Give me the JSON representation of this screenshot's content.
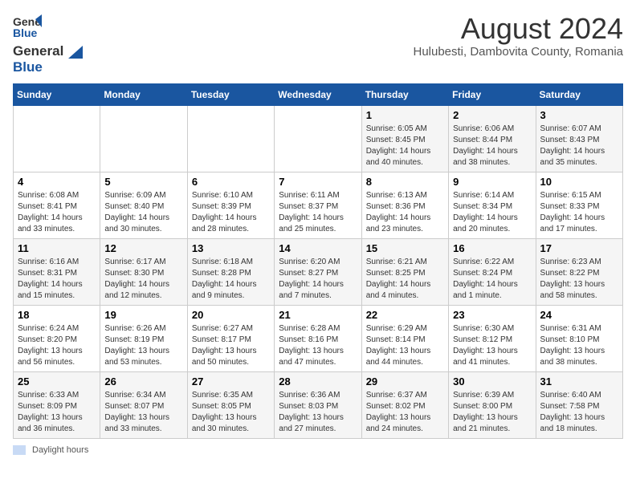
{
  "header": {
    "logo_general": "General",
    "logo_blue": "Blue",
    "month_title": "August 2024",
    "location": "Hulubesti, Dambovita County, Romania"
  },
  "weekdays": [
    "Sunday",
    "Monday",
    "Tuesday",
    "Wednesday",
    "Thursday",
    "Friday",
    "Saturday"
  ],
  "legend": {
    "box_label": "Daylight hours"
  },
  "weeks": [
    [
      {
        "day": "",
        "info": ""
      },
      {
        "day": "",
        "info": ""
      },
      {
        "day": "",
        "info": ""
      },
      {
        "day": "",
        "info": ""
      },
      {
        "day": "1",
        "info": "Sunrise: 6:05 AM\nSunset: 8:45 PM\nDaylight: 14 hours\nand 40 minutes."
      },
      {
        "day": "2",
        "info": "Sunrise: 6:06 AM\nSunset: 8:44 PM\nDaylight: 14 hours\nand 38 minutes."
      },
      {
        "day": "3",
        "info": "Sunrise: 6:07 AM\nSunset: 8:43 PM\nDaylight: 14 hours\nand 35 minutes."
      }
    ],
    [
      {
        "day": "4",
        "info": "Sunrise: 6:08 AM\nSunset: 8:41 PM\nDaylight: 14 hours\nand 33 minutes."
      },
      {
        "day": "5",
        "info": "Sunrise: 6:09 AM\nSunset: 8:40 PM\nDaylight: 14 hours\nand 30 minutes."
      },
      {
        "day": "6",
        "info": "Sunrise: 6:10 AM\nSunset: 8:39 PM\nDaylight: 14 hours\nand 28 minutes."
      },
      {
        "day": "7",
        "info": "Sunrise: 6:11 AM\nSunset: 8:37 PM\nDaylight: 14 hours\nand 25 minutes."
      },
      {
        "day": "8",
        "info": "Sunrise: 6:13 AM\nSunset: 8:36 PM\nDaylight: 14 hours\nand 23 minutes."
      },
      {
        "day": "9",
        "info": "Sunrise: 6:14 AM\nSunset: 8:34 PM\nDaylight: 14 hours\nand 20 minutes."
      },
      {
        "day": "10",
        "info": "Sunrise: 6:15 AM\nSunset: 8:33 PM\nDaylight: 14 hours\nand 17 minutes."
      }
    ],
    [
      {
        "day": "11",
        "info": "Sunrise: 6:16 AM\nSunset: 8:31 PM\nDaylight: 14 hours\nand 15 minutes."
      },
      {
        "day": "12",
        "info": "Sunrise: 6:17 AM\nSunset: 8:30 PM\nDaylight: 14 hours\nand 12 minutes."
      },
      {
        "day": "13",
        "info": "Sunrise: 6:18 AM\nSunset: 8:28 PM\nDaylight: 14 hours\nand 9 minutes."
      },
      {
        "day": "14",
        "info": "Sunrise: 6:20 AM\nSunset: 8:27 PM\nDaylight: 14 hours\nand 7 minutes."
      },
      {
        "day": "15",
        "info": "Sunrise: 6:21 AM\nSunset: 8:25 PM\nDaylight: 14 hours\nand 4 minutes."
      },
      {
        "day": "16",
        "info": "Sunrise: 6:22 AM\nSunset: 8:24 PM\nDaylight: 14 hours\nand 1 minute."
      },
      {
        "day": "17",
        "info": "Sunrise: 6:23 AM\nSunset: 8:22 PM\nDaylight: 13 hours\nand 58 minutes."
      }
    ],
    [
      {
        "day": "18",
        "info": "Sunrise: 6:24 AM\nSunset: 8:20 PM\nDaylight: 13 hours\nand 56 minutes."
      },
      {
        "day": "19",
        "info": "Sunrise: 6:26 AM\nSunset: 8:19 PM\nDaylight: 13 hours\nand 53 minutes."
      },
      {
        "day": "20",
        "info": "Sunrise: 6:27 AM\nSunset: 8:17 PM\nDaylight: 13 hours\nand 50 minutes."
      },
      {
        "day": "21",
        "info": "Sunrise: 6:28 AM\nSunset: 8:16 PM\nDaylight: 13 hours\nand 47 minutes."
      },
      {
        "day": "22",
        "info": "Sunrise: 6:29 AM\nSunset: 8:14 PM\nDaylight: 13 hours\nand 44 minutes."
      },
      {
        "day": "23",
        "info": "Sunrise: 6:30 AM\nSunset: 8:12 PM\nDaylight: 13 hours\nand 41 minutes."
      },
      {
        "day": "24",
        "info": "Sunrise: 6:31 AM\nSunset: 8:10 PM\nDaylight: 13 hours\nand 38 minutes."
      }
    ],
    [
      {
        "day": "25",
        "info": "Sunrise: 6:33 AM\nSunset: 8:09 PM\nDaylight: 13 hours\nand 36 minutes."
      },
      {
        "day": "26",
        "info": "Sunrise: 6:34 AM\nSunset: 8:07 PM\nDaylight: 13 hours\nand 33 minutes."
      },
      {
        "day": "27",
        "info": "Sunrise: 6:35 AM\nSunset: 8:05 PM\nDaylight: 13 hours\nand 30 minutes."
      },
      {
        "day": "28",
        "info": "Sunrise: 6:36 AM\nSunset: 8:03 PM\nDaylight: 13 hours\nand 27 minutes."
      },
      {
        "day": "29",
        "info": "Sunrise: 6:37 AM\nSunset: 8:02 PM\nDaylight: 13 hours\nand 24 minutes."
      },
      {
        "day": "30",
        "info": "Sunrise: 6:39 AM\nSunset: 8:00 PM\nDaylight: 13 hours\nand 21 minutes."
      },
      {
        "day": "31",
        "info": "Sunrise: 6:40 AM\nSunset: 7:58 PM\nDaylight: 13 hours\nand 18 minutes."
      }
    ]
  ]
}
